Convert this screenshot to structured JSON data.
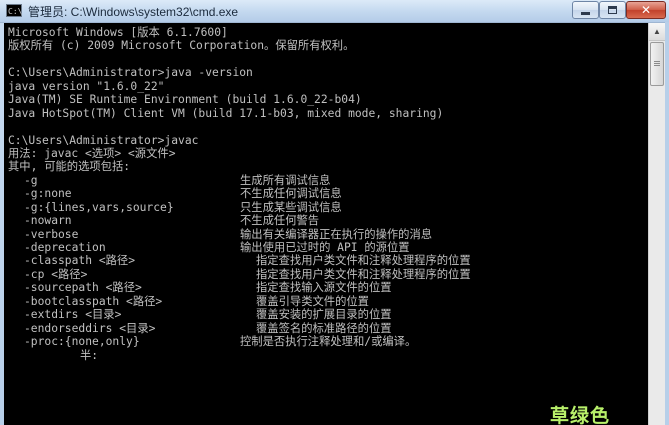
{
  "window": {
    "icon_label": "C:\\",
    "title": "管理员: C:\\Windows\\system32\\cmd.exe"
  },
  "console": {
    "lines": [
      "Microsoft Windows [版本 6.1.7600]",
      "版权所有 (c) 2009 Microsoft Corporation。保留所有权利。",
      "",
      "C:\\Users\\Administrator>java -version",
      "java version \"1.6.0_22\"",
      "Java(TM) SE Runtime Environment (build 1.6.0_22-b04)",
      "Java HotSpot(TM) Client VM (build 17.1-b03, mixed mode, sharing)",
      "",
      "C:\\Users\\Administrator>javac",
      "用法: javac <选项> <源文件>",
      "其中, 可能的选项包括:"
    ],
    "options": [
      {
        "key": "-g",
        "desc": "生成所有调试信息"
      },
      {
        "key": "-g:none",
        "desc": "不生成任何调试信息"
      },
      {
        "key": "-g:{lines,vars,source}",
        "desc": "只生成某些调试信息"
      },
      {
        "key": "-nowarn",
        "desc": "不生成任何警告"
      },
      {
        "key": "-verbose",
        "desc": "输出有关编译器正在执行的操作的消息"
      },
      {
        "key": "-deprecation",
        "desc": "输出使用已过时的 API 的源位置"
      },
      {
        "key": "-classpath <路径>",
        "desc": "指定查找用户类文件和注释处理程序的位置"
      },
      {
        "key": "-cp <路径>",
        "desc": "指定查找用户类文件和注释处理程序的位置"
      },
      {
        "key": "-sourcepath <路径>",
        "desc": "指定查找输入源文件的位置"
      },
      {
        "key": "-bootclasspath <路径>",
        "desc": "覆盖引导类文件的位置"
      },
      {
        "key": "-extdirs <目录>",
        "desc": "覆盖安装的扩展目录的位置"
      },
      {
        "key": "-endorseddirs <目录>",
        "desc": "覆盖签名的标准路径的位置"
      },
      {
        "key": "-proc:{none,only}",
        "desc": "控制是否执行注释处理和/或编译。"
      }
    ],
    "last_line": "半:"
  },
  "watermark": "草绿色",
  "colors": {
    "console_bg": "#000000",
    "console_fg": "#c0c0c0",
    "watermark": "#b8f06a",
    "close_button": "#c2412b"
  },
  "icons": {
    "minimize": "minimize-icon",
    "maximize": "maximize-icon",
    "close": "close-icon",
    "scroll_up": "chevron-up-icon"
  }
}
